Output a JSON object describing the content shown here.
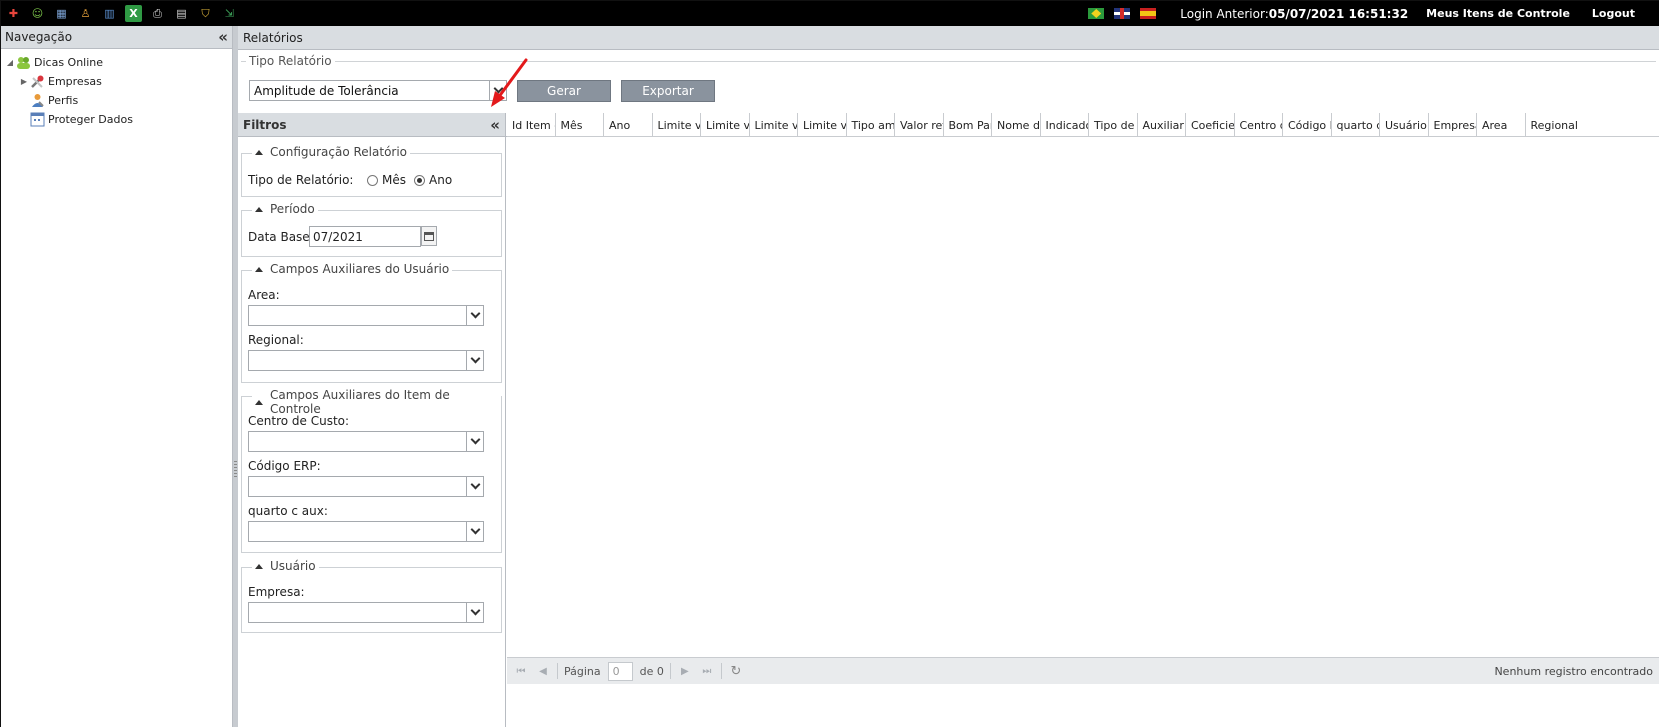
{
  "toolbar": {
    "icons": [
      {
        "name": "wrench-icon",
        "glyph": "✚",
        "color": "#e8453c"
      },
      {
        "name": "users-icon",
        "glyph": "☺",
        "color": "#7ec84b"
      },
      {
        "name": "calendar-icon",
        "glyph": "▦",
        "color": "#7da4d6"
      },
      {
        "name": "user-tools-icon",
        "glyph": "♙",
        "color": "#e7a23a"
      },
      {
        "name": "chart-icon",
        "glyph": "▥",
        "color": "#5b8fcf"
      },
      {
        "name": "excel-icon",
        "glyph": "X",
        "color": "#2f9a44"
      },
      {
        "name": "printer-icon",
        "glyph": "⎙",
        "color": "#dddddd"
      },
      {
        "name": "book-icon",
        "glyph": "▤",
        "color": "#cfcfcf"
      },
      {
        "name": "shield-icon",
        "glyph": "⛉",
        "color": "#e2b83c"
      },
      {
        "name": "export-icon",
        "glyph": "⇲",
        "color": "#3ea55b"
      }
    ]
  },
  "header": {
    "login_label": "Login Anterior:",
    "login_value": "05/07/2021 16:51:32",
    "meus_itens": "Meus Itens de Controle",
    "logout": "Logout"
  },
  "nav": {
    "title": "Navegação",
    "items": [
      {
        "label": "Dicas Online"
      },
      {
        "label": "Empresas"
      },
      {
        "label": "Perfis"
      },
      {
        "label": "Proteger Dados"
      }
    ]
  },
  "main": {
    "title": "Relatórios",
    "tipo_legend": "Tipo Relatório",
    "tipo_value": "Amplitude de Tolerância",
    "btn_gerar": "Gerar",
    "btn_exportar": "Exportar"
  },
  "filters": {
    "title": "Filtros",
    "config": {
      "legend": "Configuração Relatório",
      "tipo_label": "Tipo de Relatório:",
      "opt_mes": "Mês",
      "opt_ano": "Ano",
      "selected": "Ano"
    },
    "periodo": {
      "legend": "Período",
      "data_label": "Data Base:",
      "data_value": "07/2021"
    },
    "aux_usuario": {
      "legend": "Campos Auxiliares do Usuário",
      "area_label": "Area:",
      "regional_label": "Regional:"
    },
    "aux_item": {
      "legend": "Campos Auxiliares do Item de Controle",
      "centro_label": "Centro de Custo:",
      "codigo_label": "Código ERP:",
      "quarto_label": "quarto c aux:"
    },
    "usuario": {
      "legend": "Usuário",
      "empresa_label": "Empresa:"
    }
  },
  "grid": {
    "columns": [
      "Id Item d",
      "Mês",
      "Ano",
      "Limite ve",
      "Limite ve",
      "Limite ve",
      "Limite ve",
      "Tipo amp",
      "Valor refe",
      "Bom Para",
      "Nome do",
      "Indicador",
      "Tipo de it",
      "Auxiliar",
      "Coeficien",
      "Centro de",
      "Código E",
      "quarto c",
      "Usuário",
      "Empresa",
      "Area",
      "Regional"
    ],
    "pager": {
      "page_label": "Página",
      "page_value": "0",
      "of_label": "de 0",
      "status": "Nenhum registro encontrado"
    }
  }
}
